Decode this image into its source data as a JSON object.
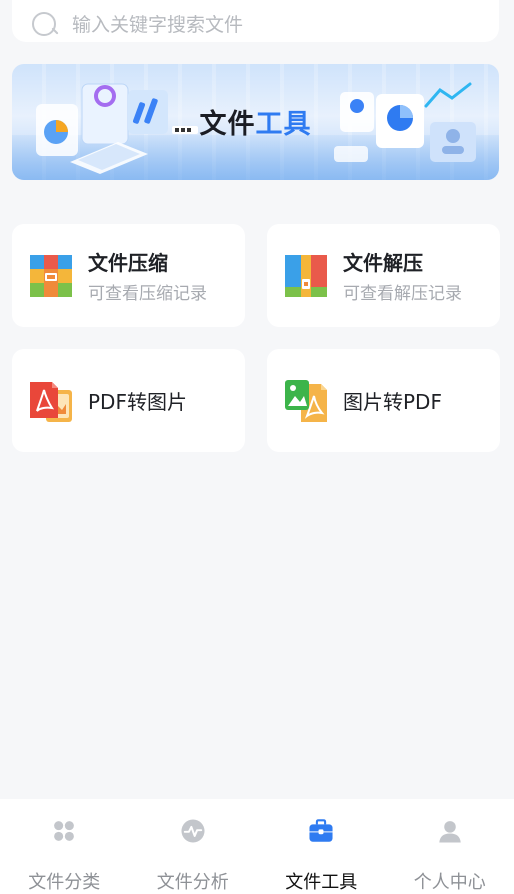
{
  "search": {
    "placeholder": "输入关键字搜索文件",
    "icon": "search-icon"
  },
  "banner": {
    "title_part1": "文件",
    "title_part2": "工具",
    "accent_color": "#2f7bf1"
  },
  "tools": [
    {
      "name": "文件压缩",
      "subtitle": "可查看压缩记录",
      "icon": "zip-archive-icon"
    },
    {
      "name": "文件解压",
      "subtitle": "可查看解压记录",
      "icon": "unzip-archive-icon"
    },
    {
      "name": "PDF转图片",
      "icon": "pdf-to-image-icon"
    },
    {
      "name": "图片转PDF",
      "icon": "image-to-pdf-icon"
    }
  ],
  "tabbar": {
    "active_color": "#2f7bf1",
    "items": [
      {
        "label": "文件分类",
        "icon": "grid-category-icon"
      },
      {
        "label": "文件分析",
        "icon": "activity-chart-icon"
      },
      {
        "label": "文件工具",
        "icon": "toolbox-icon",
        "active": true
      },
      {
        "label": "个人中心",
        "icon": "user-profile-icon"
      }
    ]
  }
}
